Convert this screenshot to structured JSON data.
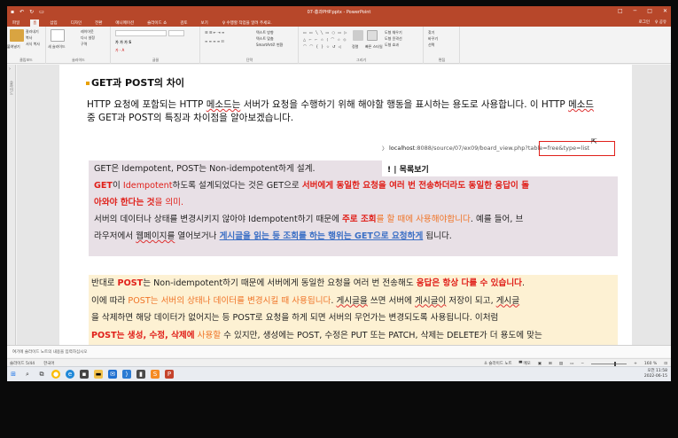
{
  "window": {
    "title": "07-흥과PHP.pptx - PowerPoint",
    "qat_icons": [
      "save-icon",
      "undo-icon",
      "redo-icon",
      "slideshow-icon"
    ],
    "controls": [
      "□",
      "─",
      "□",
      "✕"
    ]
  },
  "tabs": {
    "items": [
      "파일",
      "홈",
      "삽입",
      "디자인",
      "전환",
      "애니메이션",
      "슬라이드 쇼",
      "검토",
      "보기"
    ],
    "active_index": 1,
    "tell_me": "♀ 수행할 작업을 알려 주세요.",
    "signin": "로그인",
    "share": "♀ 공유"
  },
  "ribbon": {
    "groups": [
      "클립보드",
      "슬라이드",
      "글꼴",
      "단락",
      "그리기",
      "편집"
    ],
    "clipboard": {
      "paste": "붙여넣기",
      "cut": "잘라내기",
      "copy": "복사",
      "format": "서식 복사"
    },
    "slides": {
      "new": "새 슬라이드",
      "layout": "레이아웃",
      "reset": "다시 설정",
      "section": "구역"
    },
    "drawing": {
      "arrange": "정렬",
      "quick_styles": "빠른 스타일",
      "fill": "도형 채우기",
      "outline": "도형 윤곽선",
      "effects": "도형 효과"
    },
    "editing": {
      "find": "찾기",
      "replace": "바꾸기",
      "select": "선택"
    },
    "paragraph": {
      "text_dir": "텍스트 방향",
      "align_text": "텍스트 맞춤",
      "smartart": "SmartArt로 변환"
    }
  },
  "slide": {
    "title": "GET과 POST의 차이",
    "intro_1": "HTTP 요청에 포함되는 HTTP ",
    "intro_method1": "메소드는",
    "intro_2": " 서버가 요청을 수행하기 위해 해야할 행동을 표시하는 용도로 사용합니다. 이 HTTP ",
    "intro_method2": "메소드",
    "intro_3": " 중 GET과 POST의 특징과 차이점을 알아보겠습니다.",
    "browser": {
      "back": "〉",
      "host": "localhost",
      "path": ":8088/source/07/ex09/board_view.php",
      "query": "?table=free&type=list",
      "board_title": "| 목록보기",
      "board_title_prefix": "!"
    },
    "block1": {
      "line1": "GET은 Idempotent, POST는 Non-idempotent하게 설계.",
      "line2_a": "GET",
      "line2_b": "이 ",
      "line2_c": "Idempotent",
      "line2_d": "하도록 설계되었다는 것은 GET으로 ",
      "line2_e": "서버에게 동일한 요청을 여러 번 전송하더라도 동일한 응답이 돌",
      "line3_a": "아와야 한다는 것",
      "line3_b": "을 의미.",
      "line4_a": "서버의 데이터나 상태를 변경시키지 않아야 Idempotent하기 때문에 ",
      "line4_b": "주로 조회",
      "line4_c": "를 할 때에 사용해야합니다",
      "line4_d": ". 예를 들어, 브",
      "line5_a": "라우저에서 ",
      "line5_b": "웹페이지를",
      "line5_c": " 열어보거나 ",
      "line5_d": "게시글을 읽는 등 조회를 하는 행위는 GET으로 요청하게",
      "line5_e": " 됩니다."
    },
    "block2": {
      "line1_a": "반대로 ",
      "line1_b": "POST",
      "line1_c": "는 Non-idempotent하기 때문에 서버에게 동일한 요청을 여러 번 전송해도 ",
      "line1_d": "응답은 항상 다를 수 있습니다",
      "line1_e": ".",
      "line2_a": "이에 따라 ",
      "line2_b": "POST는 서버의 상태나 데이터를 변경시킬 때 사용됩니다",
      "line2_c": ". ",
      "line2_d": "게시글을",
      "line2_e": " 쓰면 서버에 ",
      "line2_f": "게시글이",
      "line2_g": " 저장이 되고, ",
      "line2_h": "게시글",
      "line3": "을 삭제하면 해당 데이터가 없어지는 등 POST로 요청을 하게 되면 서버의 무언가는 변경되도록 사용됩니다. 이처럼",
      "line4_a": "POST는 생성, 수정, 삭제에",
      "line4_b": " 사용할",
      "line4_c": " 수 있지만, 생성에는 POST, 수정은 PUT 또는 PATCH, 삭제는 DELETE가 더 용도에 맞는"
    }
  },
  "notes": {
    "placeholder": "여기에 슬라이드 노트의 내용을 입력하십시오"
  },
  "status": {
    "slide_counter": "슬라이드 5/44",
    "language": "한국어",
    "notes_btn": "≙ 슬라이드 노트",
    "comments_btn": "▀ 메모",
    "zoom": "160 %"
  },
  "taskbar": {
    "icons": [
      "windows-start-icon",
      "search-icon",
      "task-view-icon",
      "chrome-icon",
      "edge-icon",
      "store-icon",
      "explorer-icon",
      "mail-icon",
      "vscode-icon",
      "terminal-icon",
      "sublime-icon",
      "powerpoint-icon"
    ],
    "time": "오전 11:58",
    "date": "2022-06-15"
  },
  "colors": {
    "accent": "#b7472a",
    "red": "#e0201a",
    "orange": "#f07427",
    "blue": "#3b6fc5",
    "block1_bg": "#e8e0e6",
    "block2_bg": "#fdf1d3"
  }
}
